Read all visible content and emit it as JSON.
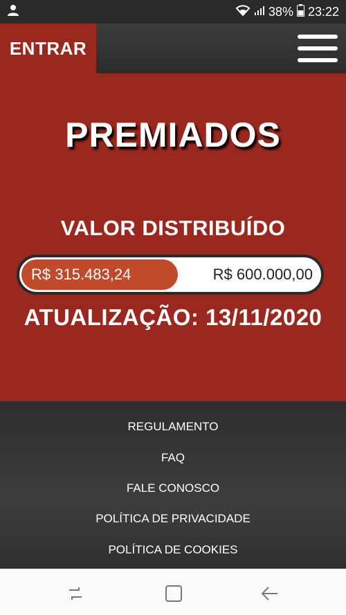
{
  "status_bar": {
    "battery": "38%",
    "time": "23:22"
  },
  "header": {
    "login_label": "ENTRAR"
  },
  "main": {
    "title": "PREMIADOS",
    "valor_label": "VALOR DISTRIBUÍDO",
    "progress": {
      "current": "R$ 315.483,24",
      "goal": "R$ 600.000,00",
      "fraction": 0.526
    },
    "update": "ATUALIZAÇÃO: 13/11/2020"
  },
  "footer": {
    "links": [
      "REGULAMENTO",
      "FAQ",
      "FALE CONOSCO",
      "POLÍTICA DE PRIVACIDADE",
      "POLÍTICA DE COOKIES"
    ]
  },
  "colors": {
    "brand_red": "#9b281f",
    "progress_fill": "#c04a2a",
    "dark": "#2a2a2a"
  },
  "icons": {
    "status_left": "user-icon",
    "status_right": [
      "wifi-icon",
      "signal-icon",
      "battery-icon"
    ],
    "menu": "hamburger-menu-icon",
    "nav": [
      "recent-apps-icon",
      "home-icon",
      "back-icon"
    ]
  }
}
